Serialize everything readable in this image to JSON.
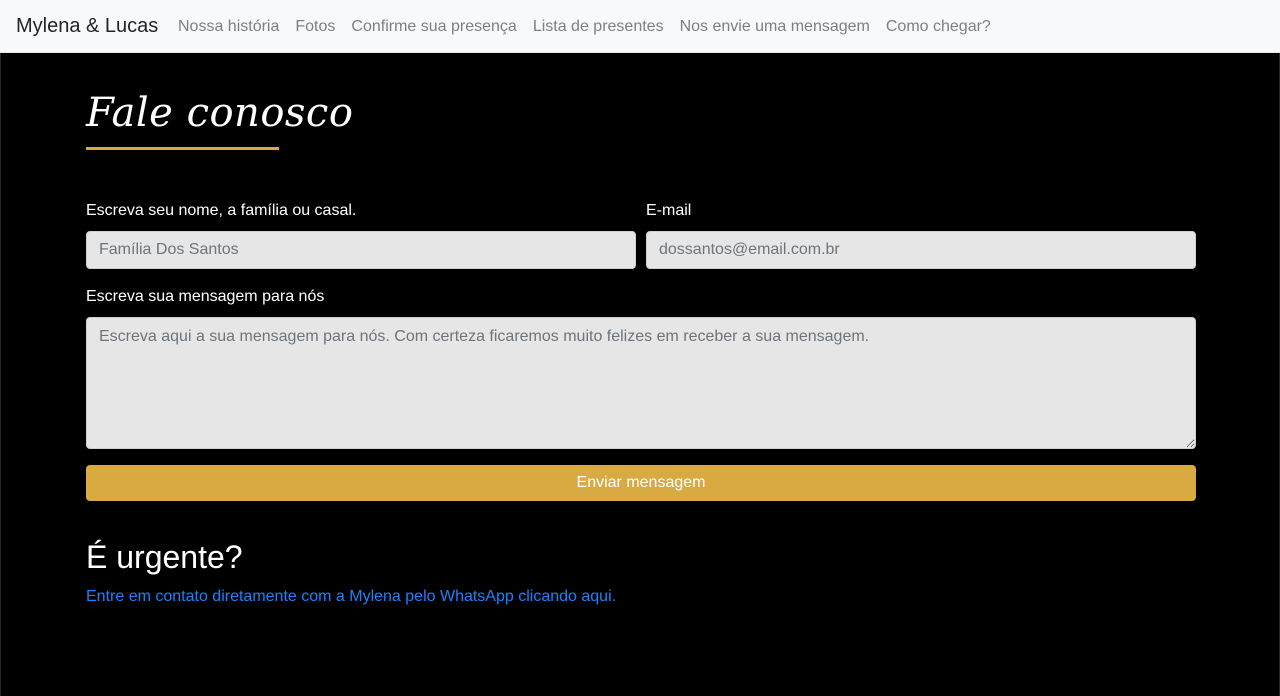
{
  "navbar": {
    "brand": "Mylena & Lucas",
    "links": [
      {
        "label": "Nossa história"
      },
      {
        "label": "Fotos"
      },
      {
        "label": "Confirme sua presença"
      },
      {
        "label": "Lista de presentes"
      },
      {
        "label": "Nos envie uma mensagem"
      },
      {
        "label": "Como chegar?"
      }
    ]
  },
  "contact": {
    "title": "Fale conosco",
    "name_label": "Escreva seu nome, a família ou casal.",
    "name_placeholder": "Família Dos Santos",
    "email_label": "E-mail",
    "email_placeholder": "dossantos@email.com.br",
    "message_label": "Escreva sua mensagem para nós",
    "message_placeholder": "Escreva aqui a sua mensagem para nós. Com certeza ficaremos muito felizes em receber a sua mensagem.",
    "submit_label": "Enviar mensagem"
  },
  "urgent": {
    "title": "É urgente?",
    "link_text": "Entre em contato diretamente com a Mylena pelo WhatsApp clicando aqui."
  },
  "colors": {
    "accent": "#d9aa42",
    "link": "#1a82ff",
    "background": "#000000",
    "navbar_bg": "#f8f9fa"
  }
}
